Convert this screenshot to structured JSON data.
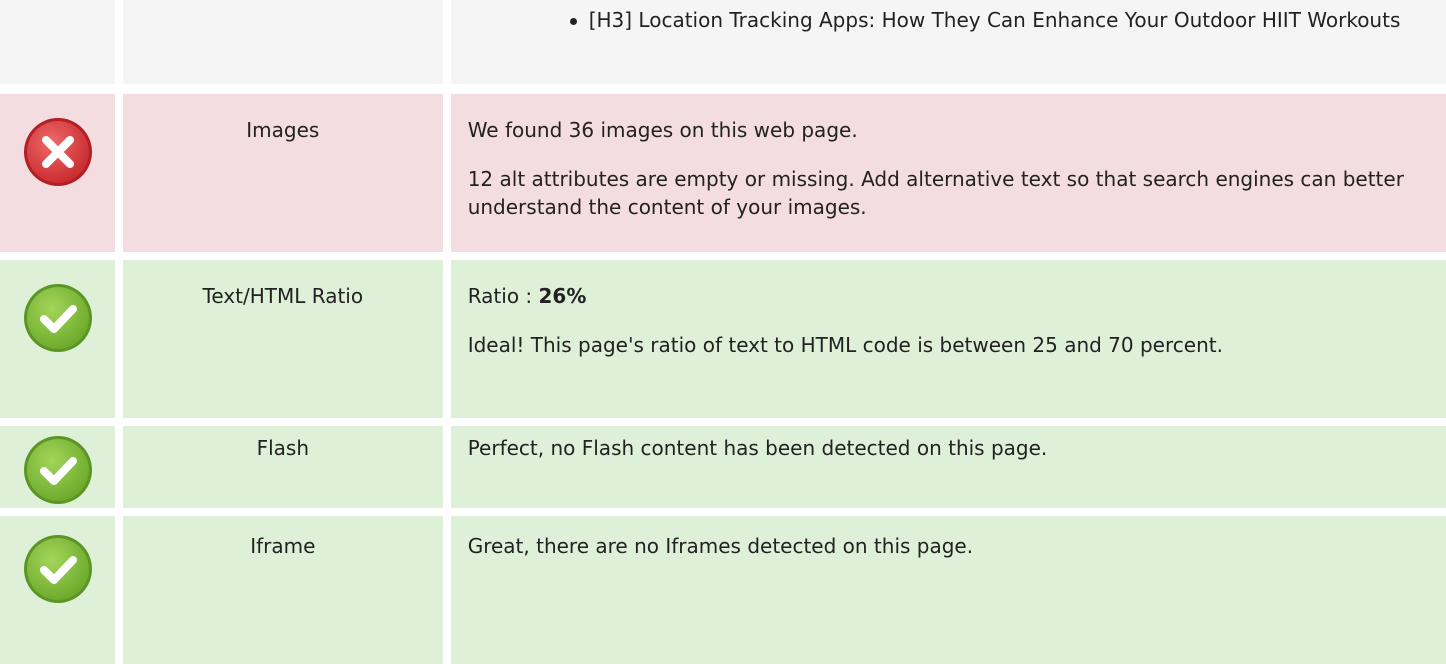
{
  "top": {
    "headings": [
      "[H3] Location Tracking Apps: How They Can Enhance Your Outdoor HIIT Workouts"
    ]
  },
  "rows": [
    {
      "status": "error",
      "icon": "error-x-icon",
      "label": "Images",
      "p1": "We found 36 images on this web page.",
      "p2": "12 alt attributes are empty or missing. Add alternative text so that search engines can better understand the content of your images."
    },
    {
      "status": "ok",
      "icon": "check-icon",
      "label": "Text/HTML Ratio",
      "p1_prefix": "Ratio : ",
      "p1_value": "26%",
      "p2": "Ideal! This page's ratio of text to HTML code is between 25 and 70 percent."
    },
    {
      "status": "ok",
      "icon": "check-icon",
      "label": "Flash",
      "p1": "Perfect, no Flash content has been detected on this page."
    },
    {
      "status": "ok",
      "icon": "check-icon",
      "label": "Iframe",
      "p1": "Great, there are no Iframes detected on this page."
    }
  ],
  "colors": {
    "error_bg": "#f3dde0",
    "ok_bg": "#dff0d8",
    "neutral_bg": "#f5f5f5",
    "error_icon": "#d83b3b",
    "ok_icon": "#7ab833"
  }
}
